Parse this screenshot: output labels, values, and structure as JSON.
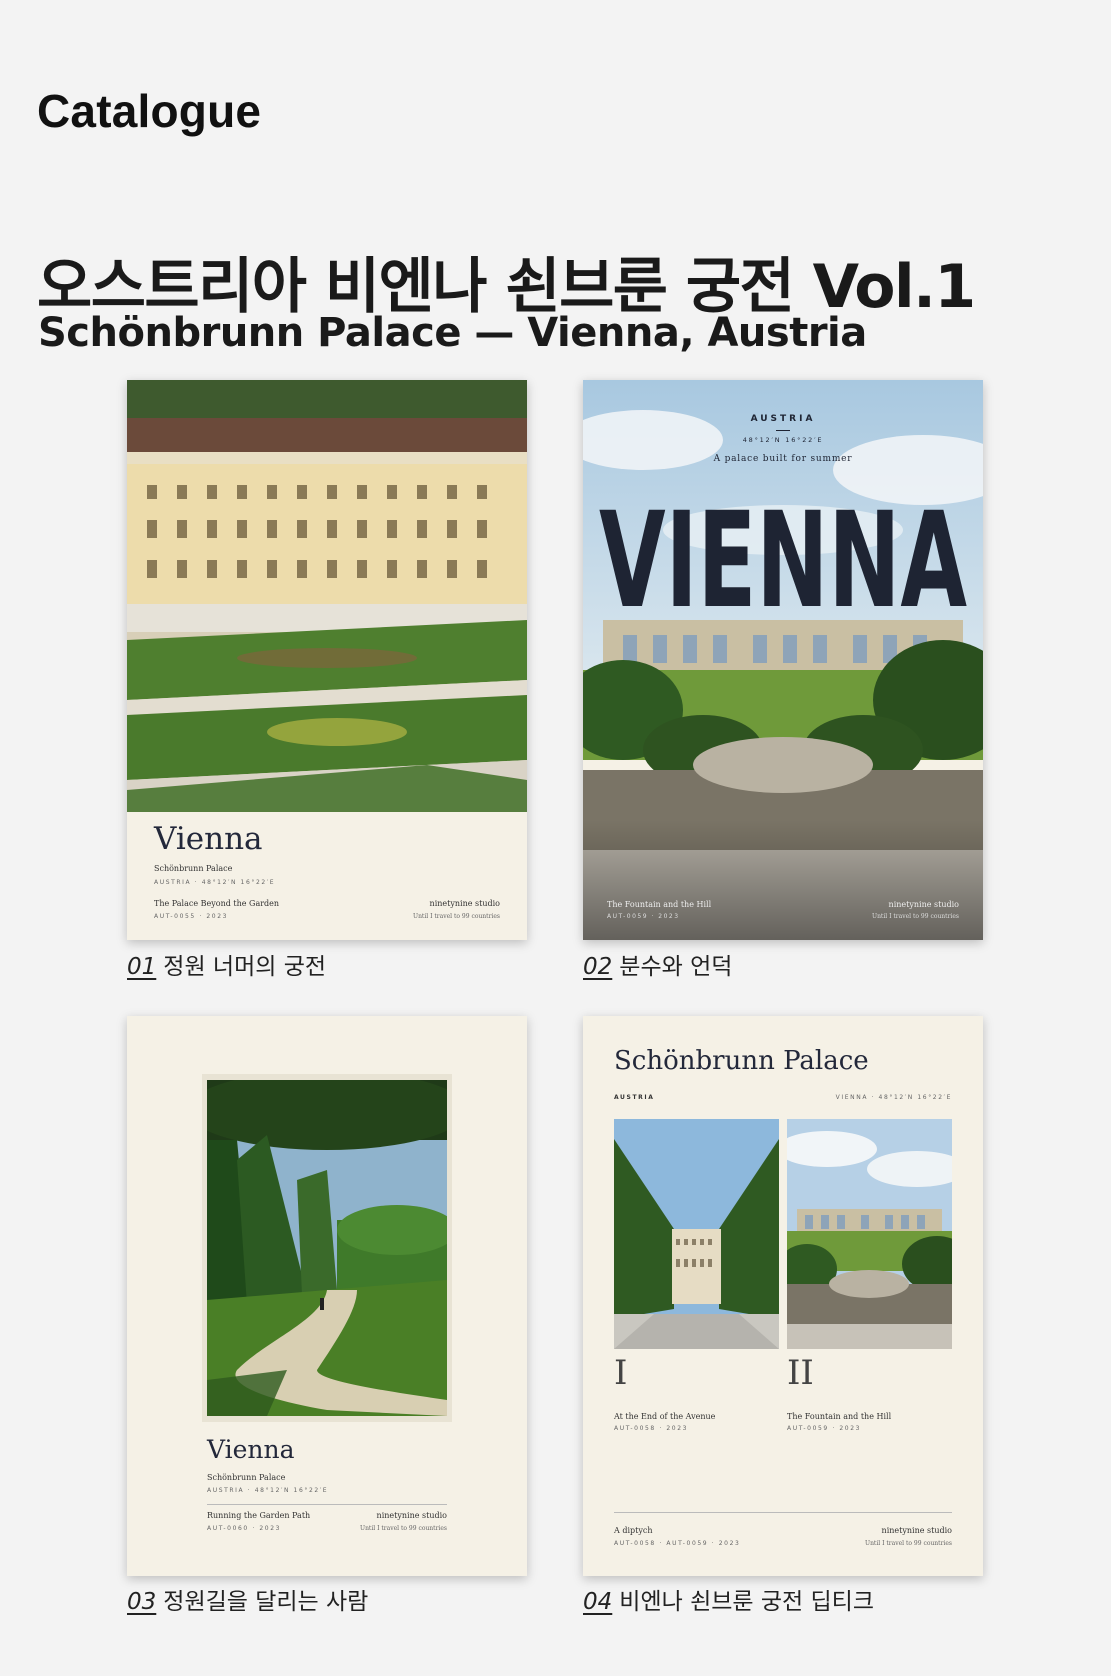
{
  "page": {
    "header_label": "Catalogue"
  },
  "collection": {
    "title_ko": "오스트리아 비엔나 쇤브룬 궁전 Vol.1",
    "title_en": "Schönbrunn Palace — Vienna, Austria"
  },
  "cards": [
    {
      "number": "01",
      "caption": "정원 너머의 궁전",
      "poster": {
        "title": "Vienna",
        "subtitle": "Schönbrunn Palace",
        "meta": "AUSTRIA · 48°12′N 16°22′E",
        "work": "The Palace Beyond the Garden",
        "code": "AUT-0055 · 2023",
        "studio": "ninetynine studio",
        "until": "Until I travel to 99 countries"
      }
    },
    {
      "number": "02",
      "caption": "분수와 언덕",
      "poster": {
        "country": "AUSTRIA",
        "coords": "48°12′N 16°22′E",
        "tagline": "A palace built for summer",
        "big_title": "VIENNA",
        "work": "The Fountain and the Hill",
        "code": "AUT-0059 · 2023",
        "studio": "ninetynine studio",
        "until": "Until I travel to 99 countries"
      }
    },
    {
      "number": "03",
      "caption": "정원길을 달리는 사람",
      "poster": {
        "title": "Vienna",
        "subtitle": "Schönbrunn Palace",
        "meta": "AUSTRIA · 48°12′N 16°22′E",
        "work": "Running the Garden Path",
        "code": "AUT-0060 · 2023",
        "studio": "ninetynine studio",
        "until": "Until I travel to 99 countries"
      }
    },
    {
      "number": "04",
      "caption": "비엔나 쇤브룬 궁전 딥티크",
      "poster": {
        "title": "Schönbrunn Palace",
        "country": "AUSTRIA",
        "coords": "VIENNA · 48°12′N 16°22′E",
        "roman1": "I",
        "roman2": "II",
        "work1": "At the End of the Avenue",
        "code1": "AUT-0058 · 2023",
        "work2": "The Fountain and the Hill",
        "code2": "AUT-0059 · 2023",
        "diptych": "A diptych",
        "diptych_code": "AUT-0058 · AUT-0059 · 2023",
        "studio": "ninetynine studio",
        "until": "Until I travel to 99 countries"
      }
    }
  ],
  "colors": {
    "ink": "#23283a",
    "paper": "#f5f1e6",
    "background": "#f3f3f3"
  }
}
